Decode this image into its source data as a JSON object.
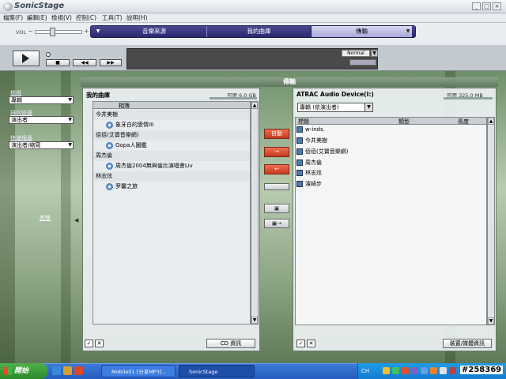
{
  "window": {
    "title": "SonicStage",
    "min": "_",
    "max": "□",
    "close": "×"
  },
  "menu": [
    "檔案(F)",
    "編輯(E)",
    "檢視(V)",
    "控制(C)",
    "工具(T)",
    "說明(H)"
  ],
  "volume": {
    "label": "VOL",
    "minus": "−",
    "plus": "+",
    "level_pct": 35
  },
  "mode_tabs": {
    "arrow_left": "▼",
    "source": "音樂來源",
    "library": "我的曲庫",
    "transfer": "傳輸",
    "arrow_right": "▼"
  },
  "player": {
    "play_mode": "Normal",
    "play_mode_arrow": "▼",
    "stop": "■",
    "prev": "◀◀",
    "next": "▶▶"
  },
  "sidebar": {
    "group1": {
      "label": "檢視",
      "value": "專輯",
      "arrow": "▼"
    },
    "group2": {
      "label": "排列依據",
      "value": "演出者",
      "arrow": "▼"
    },
    "group3": {
      "label": "快速搜尋",
      "value": "演出者/縮寫",
      "arrow": "▼"
    },
    "more": "其他",
    "collapse": "◀"
  },
  "transfer_title": "傳輸",
  "left_panel": {
    "title": "我的曲庫",
    "capacity": "可用 6.0 GB",
    "column_header": "相簿",
    "rows": [
      {
        "text": "今井美樹",
        "type": "artist"
      },
      {
        "text": "象牙白的愛情III",
        "type": "album"
      },
      {
        "text": "佰佰(艾寶音樂網)",
        "type": "artist"
      },
      {
        "text": "Gopa人圖鑑",
        "type": "album"
      },
      {
        "text": "周杰倫",
        "type": "artist"
      },
      {
        "text": "周杰倫2004無與倫比演唱會Liv",
        "type": "album"
      },
      {
        "text": "林志炫",
        "type": "artist"
      },
      {
        "text": "罗馨之旅",
        "type": "album"
      }
    ],
    "footer_button": "CD 資訊"
  },
  "middle_buttons": {
    "auto": "自動",
    "transfer_right": "→",
    "transfer_left": "←"
  },
  "right_panel": {
    "title": "ATRAC Audio Device(I:)",
    "capacity": "可用 325.0 MB",
    "view_select": "專輯 (依演出者)",
    "view_arrow": "▼",
    "columns": [
      "標題",
      "類型",
      "長度"
    ],
    "rows": [
      "w-inds.",
      "今井美樹",
      "佰佰(艾寶音樂網)",
      "周杰倫",
      "林志炫",
      "濱崎步"
    ],
    "footer_button": "裝置/媒體資訊"
  },
  "taskbar": {
    "start": "開始",
    "tasks": [
      "Mobile01 [分享MP3]...",
      "SonicStage"
    ],
    "tray_lang": "CH",
    "clock": "#258369"
  }
}
